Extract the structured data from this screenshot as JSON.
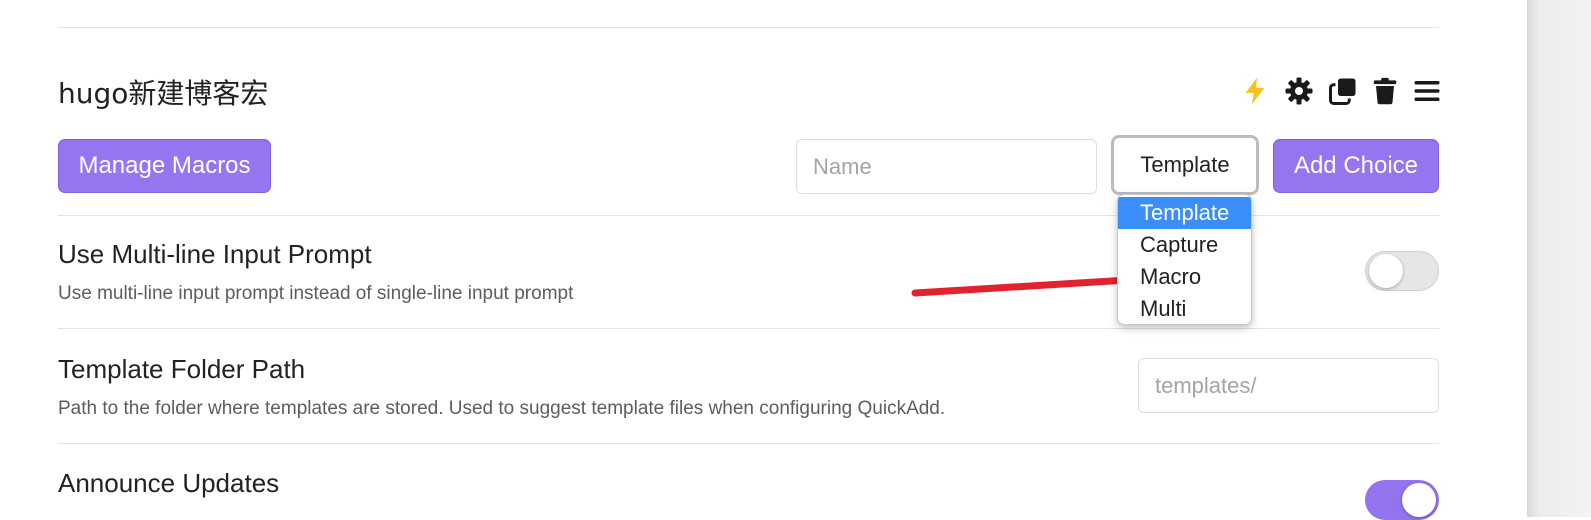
{
  "choice": {
    "title": "hugo新建博客宏",
    "icons": [
      "lightning-icon",
      "gear-icon",
      "duplicate-icon",
      "trash-icon",
      "drag-handle-icon"
    ],
    "manage_macros_label": "Manage Macros",
    "name_placeholder": "Name",
    "type_select_value": "Template",
    "type_options": [
      "Template",
      "Capture",
      "Macro",
      "Multi"
    ],
    "add_choice_label": "Add Choice"
  },
  "settings": [
    {
      "name": "Use Multi-line Input Prompt",
      "description": "Use multi-line input prompt instead of single-line input prompt",
      "toggle_on": false
    },
    {
      "name": "Template Folder Path",
      "description": "Path to the folder where templates are stored. Used to suggest template files when configuring QuickAdd.",
      "placeholder": "templates/"
    },
    {
      "name": "Announce Updates",
      "toggle_on": true
    }
  ],
  "colors": {
    "accent": "#9775f1",
    "dropdown_highlight": "#3b8ef8",
    "annotation_stroke": "#e3222f",
    "lightning": "#f4c21b"
  }
}
